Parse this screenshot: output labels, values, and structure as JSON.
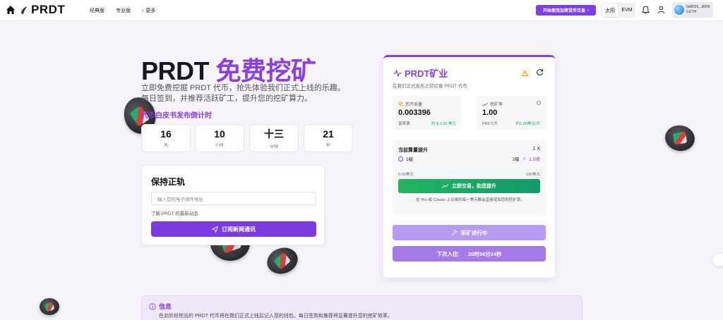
{
  "header": {
    "logo": "PRDT",
    "nav": [
      "经典版",
      "专业版"
    ],
    "more_label": "更多",
    "cta_label": "开始使用加密货币交易",
    "chain_options": [
      "太阳",
      "EVM"
    ],
    "wallet_address": "0x8D25...d6FB",
    "wallet_balance": "0 ETH"
  },
  "hero": {
    "title_main": "PRDT",
    "title_accent": "免费挖矿",
    "line1": "立即免费挖掘 PRDT 代币，抢先体验我们正式上线的乐趣。",
    "line2": "每日签到，并推荐活跃矿工，提升您的挖矿算力。",
    "countdown_title": "代币白皮书发布倒计时",
    "countdown": [
      {
        "value": "16",
        "unit": "天"
      },
      {
        "value": "10",
        "unit": "小时"
      },
      {
        "value": "十三",
        "unit": "分钟"
      },
      {
        "value": "21",
        "unit": "秒"
      }
    ]
  },
  "subscribe": {
    "title": "保持正轨",
    "placeholder": "输入您的电子邮件地址",
    "hint": "了解 PRDT 的最新动态",
    "button": "订阅新闻通讯"
  },
  "mining": {
    "title": "PRDT矿业",
    "subtitle": "在我们正式发布之前挖掘 PRDT 代币",
    "total_label": "您开采量",
    "total_value": "0.003396",
    "total_foot_l": "普莱德",
    "total_foot_r": "约 $ 0.00 美元",
    "rate_label": "挖矿率",
    "rate_value": "1.00",
    "rate_foot_l": "PRDT/天",
    "rate_foot_r": "约1.00美元/天",
    "boost_label": "当前算量提升",
    "boost_mult": "1 X",
    "level_current": "1级",
    "level_next": "2级",
    "level_next_mult": "1.5倍",
    "range_min": "0.00美元",
    "range_max": "100美元",
    "trade_button": "立即交易，助您提升",
    "trade_note": "在 Pro 或 Classic 上交易的每一美元都会直接增加您的挖矿率。",
    "mining_button": "采矿进行中",
    "next_label": "下次入住:",
    "next_time": "20时56分24秒"
  },
  "info": {
    "title": "信息",
    "text": "在此阶段挖出的 PRDT 代币将在我们正式上线后记入您的钱包。每日签到和推荐将显著提升您的挖矿效率。"
  },
  "colors": {
    "accent": "#8a3fe0",
    "green": "#22b560"
  }
}
